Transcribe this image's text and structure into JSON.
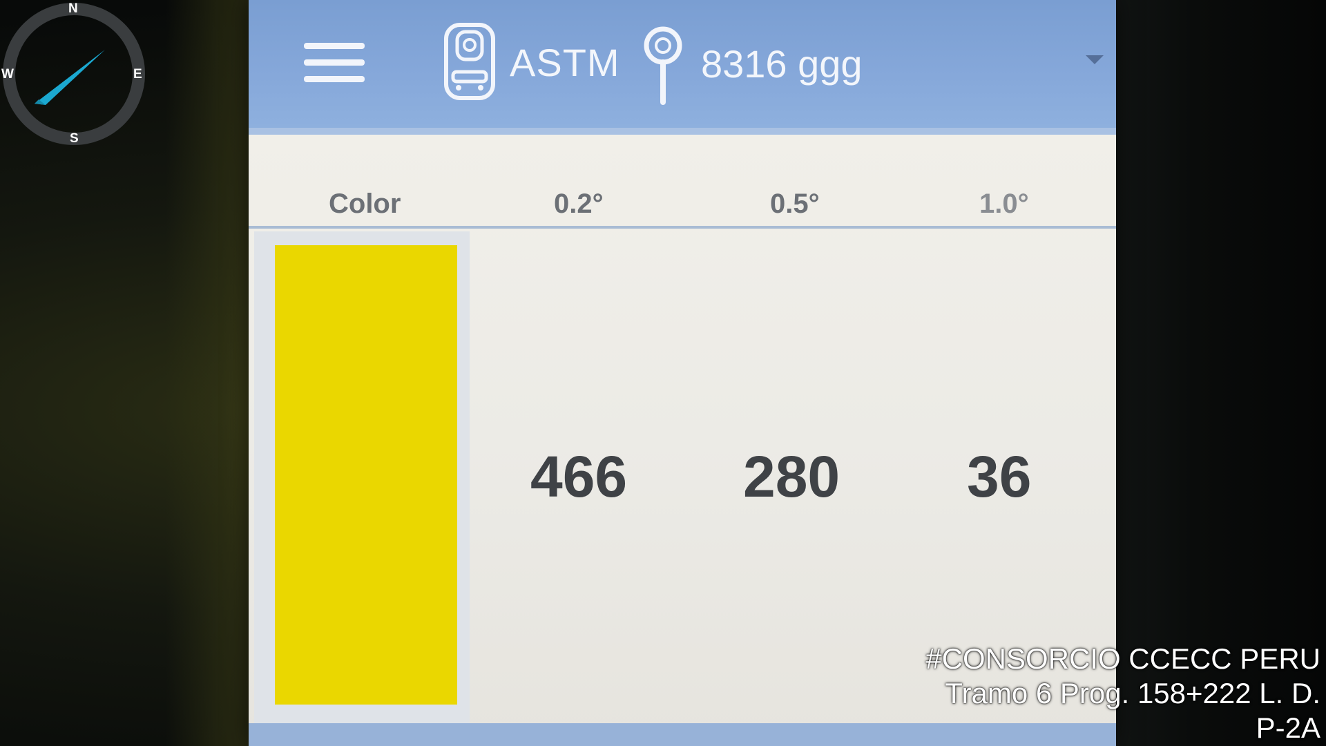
{
  "appbar": {
    "standard": "ASTM",
    "location": "8316 ggg"
  },
  "table": {
    "headers": [
      "Color",
      "0.2°",
      "0.5°",
      "1.0°"
    ],
    "swatch_color": "#EAD700",
    "values": [
      "466",
      "280",
      "36"
    ]
  },
  "compass": {
    "north": "N",
    "south": "S",
    "east": "E",
    "west": "W",
    "needle_color": "#1BA8D0"
  },
  "watermark": {
    "line1": "#CONSORCIO CCECC PERU",
    "line2": "Tramo 6 Prog. 158+222 L. D.",
    "line3": "P-2A"
  },
  "colors": {
    "appbar": "#7A9ED2",
    "screen_background": "#ECEBE6",
    "header_text": "#6C7076",
    "value_text": "#3F4246"
  }
}
